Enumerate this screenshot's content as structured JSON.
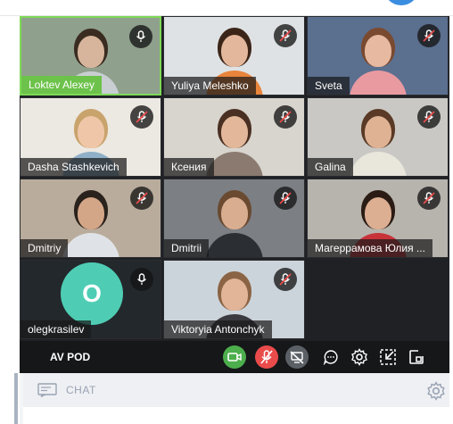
{
  "participants": [
    {
      "name": "Loktev Alexey",
      "muted": false,
      "active": true,
      "bg": "#8fa08d",
      "skin": "#d7b59c",
      "hair": "#3a2c20",
      "shirt": "#c9ced2"
    },
    {
      "name": "Yuliya Meleshko",
      "muted": true,
      "active": false,
      "bg": "#dfe2e4",
      "skin": "#e3b79c",
      "hair": "#3b2518",
      "shirt": "#e8843c"
    },
    {
      "name": "Sveta",
      "muted": true,
      "active": false,
      "bg": "#5b6f8f",
      "skin": "#e7b9a0",
      "hair": "#7a4a30",
      "shirt": "#e99aa0"
    },
    {
      "name": "Dasha Stashkevich",
      "muted": true,
      "active": false,
      "bg": "#ece8e2",
      "skin": "#efc7a8",
      "hair": "#c9a36c",
      "shirt": "#8fb0c8"
    },
    {
      "name": "Ксения",
      "muted": true,
      "active": false,
      "bg": "#d8d4ce",
      "skin": "#e3b89a",
      "hair": "#4a3022",
      "shirt": "#8a7a70"
    },
    {
      "name": "Galina",
      "muted": true,
      "active": false,
      "bg": "#c9c8c4",
      "skin": "#dfb294",
      "hair": "#5a3a26",
      "shirt": "#e9e6dc"
    },
    {
      "name": "Dmitriy",
      "muted": true,
      "active": false,
      "bg": "#b9ac9c",
      "skin": "#d4a688",
      "hair": "#2a221c",
      "shirt": "#dfe3e7"
    },
    {
      "name": "Dmitrii",
      "muted": true,
      "active": false,
      "bg": "#7c7f84",
      "skin": "#d8ad90",
      "hair": "#6a4a30",
      "shirt": "#2b2e33"
    },
    {
      "name": "Магеррамова Юлия ...",
      "muted": true,
      "active": false,
      "bg": "#b7b3ad",
      "skin": "#dcae92",
      "hair": "#2a1c14",
      "shirt": "#c8333a"
    },
    {
      "name": "olegkrasilev",
      "muted": false,
      "active": false,
      "initial": "O",
      "bg": "#23282c"
    },
    {
      "name": "Viktoryia Antonchyk",
      "muted": true,
      "active": false,
      "bg": "#ccd4db",
      "skin": "#e2b598",
      "hair": "#8a6444",
      "shirt": "#3a3b40"
    }
  ],
  "toolbar": {
    "room_name": "AV POD",
    "buttons": [
      {
        "name": "camera-button",
        "icon": "camera-icon",
        "color": "#4cae4c"
      },
      {
        "name": "microphone-button",
        "icon": "mic-off-icon",
        "color": "#e94b4b"
      },
      {
        "name": "screen-share-button",
        "icon": "screen-share-off-icon",
        "color": "#5b6066"
      },
      {
        "name": "chat-toggle-button",
        "icon": "chat-bubble-icon"
      },
      {
        "name": "settings-button",
        "icon": "gear-icon"
      },
      {
        "name": "minimize-button",
        "icon": "minimize-icon"
      },
      {
        "name": "popout-button",
        "icon": "popout-icon"
      }
    ]
  },
  "chat": {
    "title": "CHAT",
    "icon": "chat-icon",
    "settings_icon": "gear-icon"
  },
  "colors": {
    "active_speaker": "#7ed957",
    "toolbar_bg": "#151719",
    "grid_bg": "#1f2125",
    "chat_header_text": "#9aa3b2"
  }
}
